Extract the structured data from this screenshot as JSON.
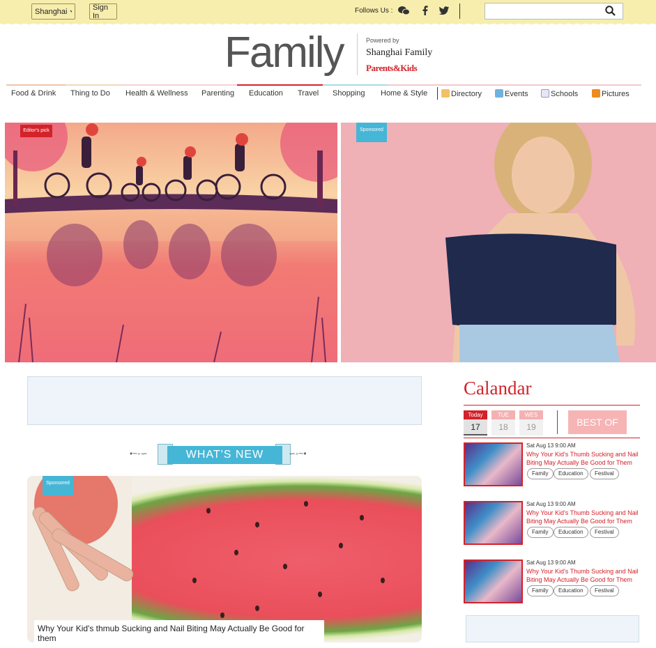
{
  "topbar": {
    "city": "Shanghai",
    "sign_in": "Sign In",
    "follows_label": "Follows Us :",
    "search_placeholder": ""
  },
  "logo": {
    "text": "Family",
    "powered_by": "Powered by",
    "brand_line": "Shanghai Family",
    "brand_sub": "Parents&Kids"
  },
  "nav": {
    "items": [
      "Food & Drink",
      "Thing to Do",
      "Health & Wellness",
      "Parenting",
      "Education",
      "Travel",
      "Shopping",
      "Home & Style"
    ],
    "tools": [
      "Directory",
      "Events",
      "Schools",
      "Pictures"
    ]
  },
  "hero": {
    "left_tag": "Editor's pick",
    "right_tag": "Sponsored"
  },
  "whats_new": {
    "banner": "WHAT'S NEW",
    "card_tag": "Sponsored",
    "card_title": "Why Your Kid's thmub Sucking and Nail Biting May Actually Be Good for them"
  },
  "calendar": {
    "title": "Calandar",
    "days": [
      {
        "label": "Today",
        "num": "17"
      },
      {
        "label": "TUE",
        "num": "18"
      },
      {
        "label": "WES",
        "num": "19"
      }
    ],
    "best_of": "BEST OF",
    "events": [
      {
        "date": "Sat Aug 13 9:00 AM",
        "title": "Why Your Kid's Thumb Sucking and Nail Biting May Actually Be Good for Them",
        "tags": [
          "Family",
          "Education",
          "Festival"
        ]
      },
      {
        "date": "Sat Aug 13 9:00 AM",
        "title": "Why Your Kid's Thumb Sucking and Nail Biting May Actually Be Good for Them",
        "tags": [
          "Family",
          "Education",
          "Festival"
        ]
      },
      {
        "date": "Sat Aug 13 9:00 AM",
        "title": "Why Your Kid's Thumb Sucking and Nail Biting May Actually Be Good for Them",
        "tags": [
          "Family",
          "Education",
          "Festival"
        ]
      }
    ]
  },
  "colors": {
    "accent": "#d3222a",
    "topbar": "#f7eeae",
    "whats_new": "#46b6d6"
  }
}
